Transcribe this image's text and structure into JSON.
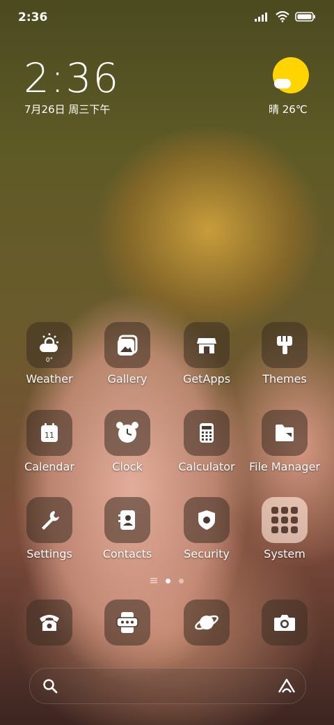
{
  "status_bar": {
    "time": "2:36"
  },
  "clock": {
    "time": "2:36",
    "date": "7月26日 周三下午"
  },
  "weather_widget": {
    "text": "晴 26℃"
  },
  "apps": [
    {
      "label": "Weather",
      "icon": "weather-icon"
    },
    {
      "label": "Gallery",
      "icon": "gallery-icon"
    },
    {
      "label": "GetApps",
      "icon": "getapps-icon"
    },
    {
      "label": "Themes",
      "icon": "themes-icon"
    },
    {
      "label": "Calendar",
      "icon": "calendar-icon",
      "icon_text": "11"
    },
    {
      "label": "Clock",
      "icon": "clock-icon"
    },
    {
      "label": "Calculator",
      "icon": "calculator-icon"
    },
    {
      "label": "File Manager",
      "icon": "file-manager-icon"
    },
    {
      "label": "Settings",
      "icon": "settings-icon"
    },
    {
      "label": "Contacts",
      "icon": "contacts-icon"
    },
    {
      "label": "Security",
      "icon": "security-icon"
    },
    {
      "label": "System",
      "icon": "system-folder-icon"
    }
  ],
  "weather_icon_text": "0°",
  "page_indicator": {
    "pages": 2,
    "current": 1
  },
  "dock": [
    {
      "icon": "phone-icon"
    },
    {
      "icon": "messages-icon"
    },
    {
      "icon": "browser-icon"
    },
    {
      "icon": "camera-icon"
    }
  ],
  "search_bar": {
    "left_icon": "search-icon",
    "right_icon": "assistant-icon"
  }
}
